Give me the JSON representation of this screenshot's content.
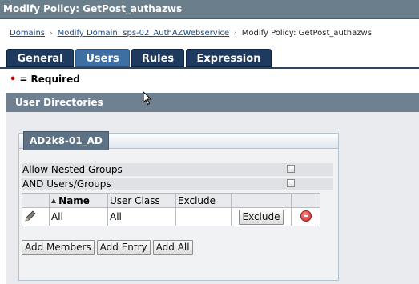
{
  "window": {
    "title": "Modify Policy: GetPost_authazws"
  },
  "breadcrumb": {
    "items": [
      "Domains",
      "Modify Domain: sps-02_AuthAZWebservice"
    ],
    "separator": "›",
    "current": "Modify Policy: GetPost_authazws"
  },
  "tabs": [
    {
      "label": "General",
      "active": false
    },
    {
      "label": "Users",
      "active": true
    },
    {
      "label": "Rules",
      "active": false
    },
    {
      "label": "Expression",
      "active": false
    }
  ],
  "required": {
    "marker": "•",
    "text": "= Required"
  },
  "section": {
    "title": "User Directories",
    "directory": {
      "name": "AD2k8-01_AD",
      "options": [
        {
          "label": "Allow Nested Groups",
          "checked": false
        },
        {
          "label": "AND Users/Groups",
          "checked": false
        }
      ],
      "table": {
        "headers": [
          "",
          "Name",
          "User Class",
          "Exclude",
          ""
        ],
        "rows": [
          {
            "name": "All",
            "user_class": "All",
            "exclude": "",
            "action": "Exclude"
          }
        ]
      },
      "buttons": [
        "Add Members",
        "Add Entry",
        "Add All"
      ]
    }
  },
  "icons": {
    "edit": "pencil-icon",
    "remove": "remove-icon",
    "sort": "sort-ascending-icon",
    "cursor": "mouse-pointer-icon"
  },
  "colors": {
    "titlebar": "#6b7e8c",
    "tab": "#1f3a5f",
    "tab_active": "#3f6ea3",
    "panel_header": "#6f8091",
    "required_dot": "#cc0000"
  }
}
